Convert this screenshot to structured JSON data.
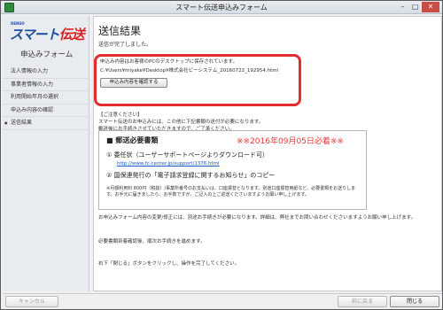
{
  "window": {
    "title": "スマート伝送申込みフォーム",
    "controls": [
      "–",
      "□",
      "✕"
    ]
  },
  "sidebar": {
    "logo": {
      "brand_small": "DENSO",
      "brand_main_blue": "スマート",
      "brand_main_red": "伝送",
      "subtitle": "申込みフォーム"
    },
    "items": [
      {
        "label": "法人情報の入力"
      },
      {
        "label": "事業者情報の入力"
      },
      {
        "label": "利用開始年月の選択"
      },
      {
        "label": "申込み内容の確認"
      },
      {
        "label": "送信結果"
      }
    ],
    "active_index": 4
  },
  "content": {
    "heading": "送信結果",
    "sent_message": "送信が完了しました。",
    "saved_line": "申込み内容はお客様のPCのデスクトップに保存されています。",
    "saved_path": "C:¥Users¥miyake¥Desktop¥株式会社ビーシステム_20160722_192954.html",
    "confirm_button": "申込み内容を確認する",
    "notice": {
      "title": "【ご注意ください】",
      "line1": "スマート伝送のお申込みには、この他に下記書類の送付が必要になります。",
      "line2": "郵送後にお手続きさせていただきますので、ご了承ください。"
    },
    "mail": {
      "title": "■ 郵送必要書類",
      "must_text": "※※2016年09月05日必着※※",
      "item1": "① 委任状（ユーザーサポートページよりダウンロード可）",
      "link": "http://www.fc-center.jp/support/1376.html",
      "item2": "② 国保連発行の「電子請求登録に関するお知らせ」のコピー",
      "note": "※月額利用料 800円（税抜）/事業所番号のお支払いは、口座振替となります。別途口座振替用紙など、必要書類をお送りします。お手元に届きましたら、お手数ですが、ご記入の上ご返送くださいますようお願い申し上げます。"
    },
    "after1": "お申込みフォーム内容の変更/修正には、別途お手続きが必要になります。詳細は、弊社までお問い合わせくださいますようお願い申し上げます。",
    "after2": "必要書類到着確認後、順次お手続きを進めます。",
    "after3": "右下「閉じる」ボタンをクリックし、操作を完了してください。"
  },
  "footer": {
    "cancel": "キャンセル",
    "prev": "前に戻る",
    "close": "閉じる"
  }
}
